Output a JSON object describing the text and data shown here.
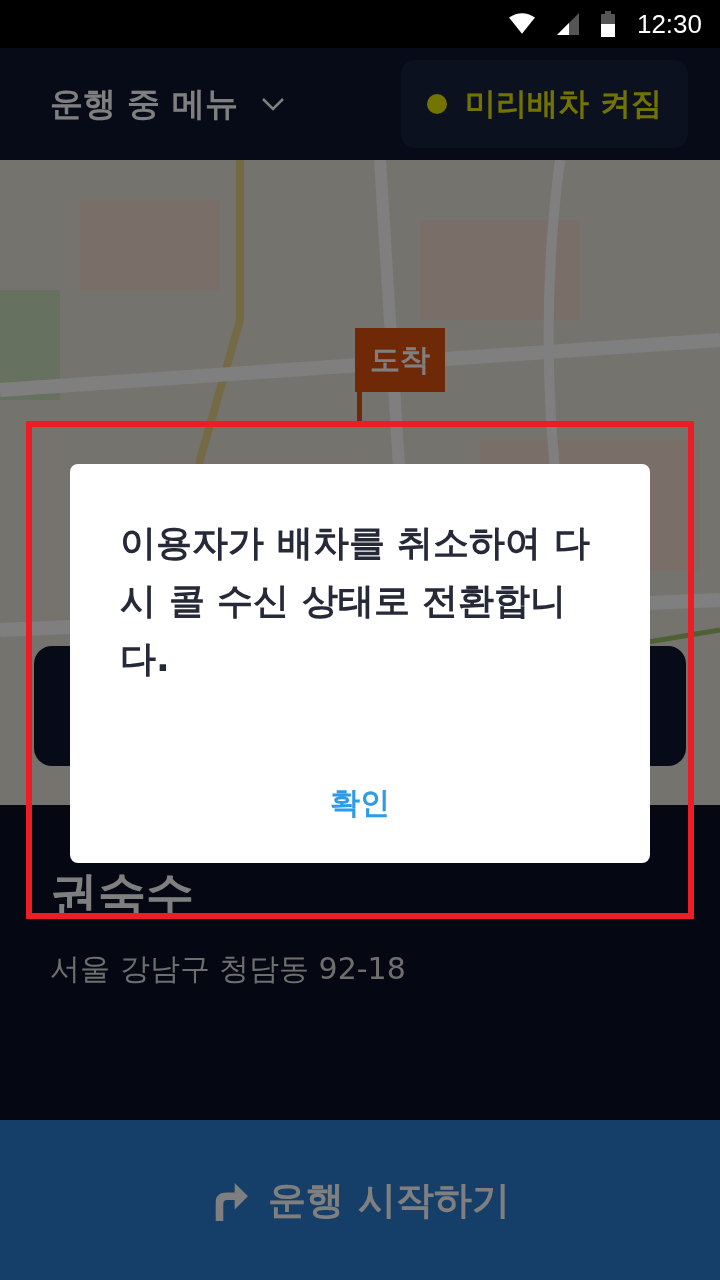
{
  "status_bar": {
    "time": "12:30"
  },
  "header": {
    "menu_title": "운행 중 메뉴",
    "pre_dispatch": {
      "label": "미리배차 켜짐",
      "on": true
    }
  },
  "map": {
    "kind": "picture",
    "marker": "도착"
  },
  "passenger": {
    "name": "권숙수",
    "address": "서울 강남구 청담동 92-18"
  },
  "start_button": {
    "label": "운행 시작하기"
  },
  "dialog": {
    "message": "이용자가 배차를 취소하여 다시 콜 수신 상태로 전환합니다.",
    "confirm": "확인"
  }
}
